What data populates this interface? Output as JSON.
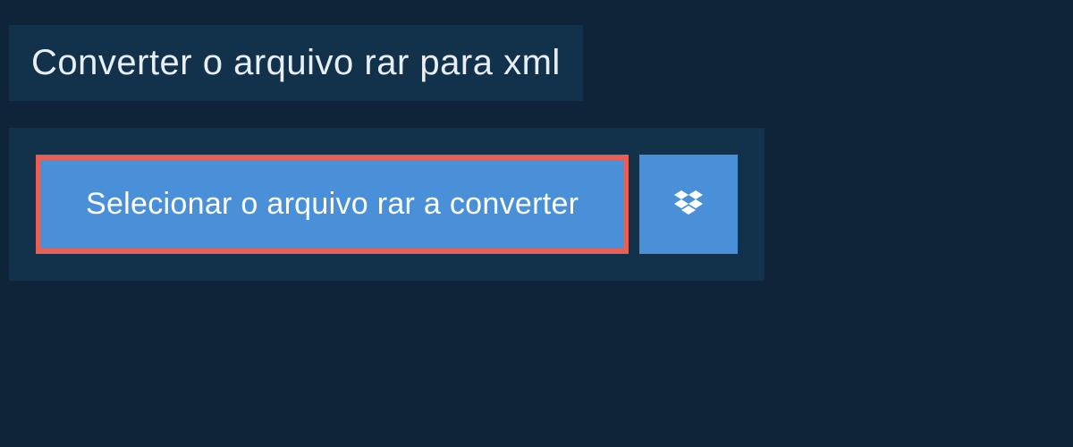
{
  "header": {
    "title": "Converter o arquivo rar para xml"
  },
  "upload": {
    "select_button_label": "Selecionar o arquivo rar a converter"
  }
}
